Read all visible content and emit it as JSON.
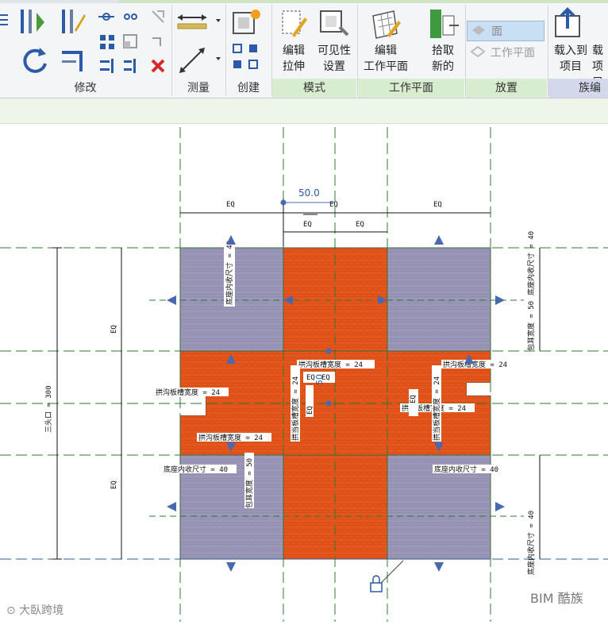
{
  "ribbon": {
    "panels": {
      "modify": "修改",
      "measure": "测量",
      "create": "创建",
      "mode": "模式",
      "workplane": "工作平面",
      "place": "放置",
      "family_editor": "族编辑"
    },
    "buttons": {
      "edit_extrusion": [
        "编辑",
        "拉伸"
      ],
      "visibility_settings": [
        "可见性",
        "设置"
      ],
      "edit_workplane": [
        "编辑",
        "工作平面"
      ],
      "pick_new": [
        "拾取",
        "新的"
      ],
      "face": "面",
      "workplane_place": "工作平面",
      "load_into_project": [
        "载入到",
        "项目"
      ],
      "load_into_project_close": [
        "载",
        "项目"
      ]
    }
  },
  "drawing": {
    "dimensions": {
      "top_value": "50.0",
      "eq": "EQ",
      "left_total": "三头口 = 300",
      "base_inner_40": "底座内收尺寸 = 40",
      "ear_width_50": "包耳宽度 = 50",
      "base_inner_50": "包耳宽度 = 50",
      "groove_24": "拱沟板槽宽度 = 24",
      "slot_depth_24": "拱当板槽宽度 = 24",
      "small_50": "50",
      "eq_small": "EQ"
    }
  },
  "colors": {
    "orange": "#e4561d",
    "purple": "#9a97b8",
    "dash_green": "#2f7a2f",
    "blue_marker": "#4a68b0"
  },
  "watermarks": {
    "left": "⊙ 大臥跨境",
    "right": "BIM 酷族"
  }
}
